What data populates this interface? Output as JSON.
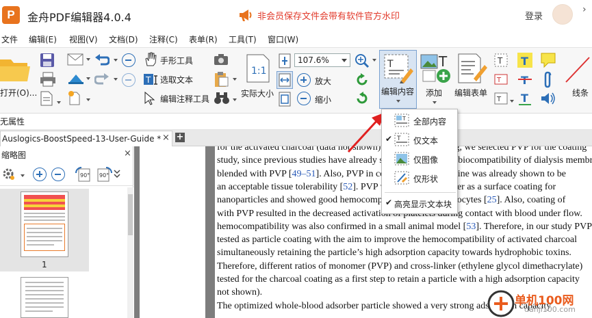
{
  "app": {
    "title": "金舟PDF编辑器4.0.4",
    "logo_letter": "P",
    "promo_text": "非会员保存文件会带有软件官方水印",
    "login": "登录",
    "more": "›"
  },
  "menu": [
    "文件",
    "编辑(E)",
    "视图(V)",
    "文档(D)",
    "注释(C)",
    "表单(R)",
    "工具(T)",
    "窗口(W)"
  ],
  "toolbar": {
    "open_label": "打开(O)...",
    "hand_tool": "手形工具",
    "select_text": "选取文本",
    "edit_annotation_tool": "编辑注释工具",
    "actual_size": "实际大小",
    "zoom_value": "107.6%",
    "zoom_in": "放大",
    "zoom_out": "缩小",
    "edit_content": "编辑内容",
    "add": "添加",
    "edit_form": "编辑表单",
    "line": "线条"
  },
  "properties_bar": {
    "label": "无属性"
  },
  "tab": {
    "title": "Auslogics-BoostSpeed-13-User-Guide *",
    "close": "×",
    "new": "+"
  },
  "thumbnails": {
    "title": "缩略图",
    "close": "×",
    "page1_number": "1"
  },
  "dropdown": {
    "items": [
      {
        "label": "全部内容",
        "checked": false
      },
      {
        "label": "仅文本",
        "checked": true
      },
      {
        "label": "仅图像",
        "checked": false
      },
      {
        "label": "仅形状",
        "checked": false
      }
    ],
    "highlight": {
      "label": "高亮显示文本块",
      "checked": true
    },
    "check_mark": "✔"
  },
  "document": {
    "lines": [
      {
        "parts": [
          "for the activated charcoal (data not shown). From the screening, we selected PVP for the coating"
        ]
      },
      {
        "parts": [
          "study, since previous studies have already shown the excellent biocompatibility of dialysis membranes"
        ]
      },
      {
        "parts": [
          "blended with PVP [",
          "49–51",
          "]. Also, PVP in combination with iodine was already shown to be"
        ]
      },
      {
        "parts": [
          "an acceptable tissue tolerability [",
          "52",
          "]. PVP was also tested earlier as a surface coating for"
        ]
      },
      {
        "parts": [
          "nanoparticles and showed good hemocompatibility with erythrocytes [",
          "25",
          "]. Also, coating of"
        ]
      },
      {
        "parts": [
          "with PVP resulted in the decreased activation of platelets during contact with blood under flow."
        ]
      },
      {
        "parts": [
          "hemocompatibility was also confirmed in a small animal model [",
          "53",
          "]. Therefore, in our study PVP"
        ]
      },
      {
        "parts": [
          "tested as particle coating with the aim to improve the hemocompatibility of activated charcoal"
        ]
      },
      {
        "parts": [
          "simultaneously retaining the particle’s high adsorption capacity towards hydrophobic toxins."
        ]
      },
      {
        "parts": [
          "Therefore, different ratios of monomer (PVP) and cross-linker (ethylene glycol dimethacrylate)"
        ]
      },
      {
        "parts": [
          "tested for the charcoal coating as a first step to retain a particle with a high adsorption capacity"
        ]
      },
      {
        "parts": [
          "not shown)."
        ]
      },
      {
        "parts": [
          "    The optimized whole-blood adsorber particle showed a very strong adsorption capacity"
        ]
      }
    ]
  },
  "watermark": {
    "text": "单机100网",
    "sub": "danji100.com"
  },
  "colors": {
    "accent": "#2d6fb7",
    "promo": "#e23b2c",
    "logo": "#e8731e",
    "citation": "#2b5bb8",
    "selected_button": "#d8e4f2"
  }
}
